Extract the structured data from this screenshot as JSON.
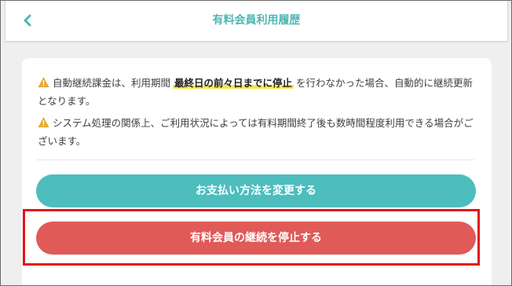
{
  "header": {
    "title": "有料会員利用履歴",
    "back_icon": "chevron-left-icon",
    "accent_color": "#4fb7b4"
  },
  "notices": [
    {
      "icon": "warning-icon",
      "text_before": "自動継続課金は、利用期間",
      "highlight": "最終日の前々日までに停止",
      "text_after": "を行わなかった場合、自動的に継続更新となります。"
    },
    {
      "icon": "warning-icon",
      "text": "システム処理の関係上、ご利用状況によっては有料期間終了後も数時間程度利用できる場合がございます。"
    }
  ],
  "buttons": {
    "change_payment": "お支払い方法を変更する",
    "stop_membership": "有料会員の継続を停止する"
  },
  "colors": {
    "teal_button": "#4dbdbd",
    "red_button": "#e05a58",
    "highlight_border": "#e0141d",
    "marker": "#f5e84a"
  }
}
